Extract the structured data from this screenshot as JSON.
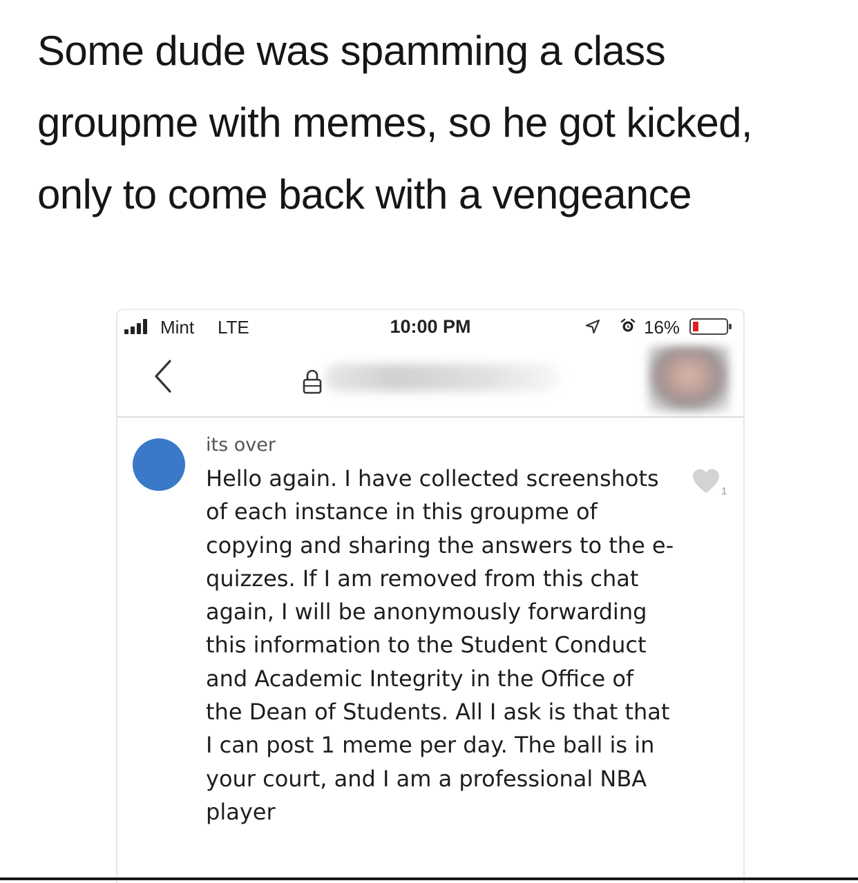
{
  "post": {
    "caption": "Some dude was spamming a class groupme with memes, so he got kicked, only to come back with a vengeance"
  },
  "status_bar": {
    "carrier": "Mint",
    "network": "LTE",
    "time": "10:00 PM",
    "battery_percent": "16%",
    "battery_level": 0.16,
    "icons": [
      "signal-icon",
      "location-icon",
      "alarm-icon",
      "battery-icon"
    ]
  },
  "nav_bar": {
    "icons": [
      "back-icon",
      "lock-icon"
    ]
  },
  "message": {
    "sender": "its over",
    "text": "Hello again. I have collected screenshots of each instance in this groupme of copying and sharing the answers to the e-quizzes. If I am removed from this chat again, I will be anonymously forwarding this information to the Student Conduct and Academic Integrity in the Office of the Dean of Students. All I ask is that that I can post 1 meme per day. The ball is in your court, and I am a professional NBA player",
    "like_count": "1",
    "colors": {
      "avatar": "#3a78c8",
      "like_heart": "#d3d3d3"
    }
  }
}
